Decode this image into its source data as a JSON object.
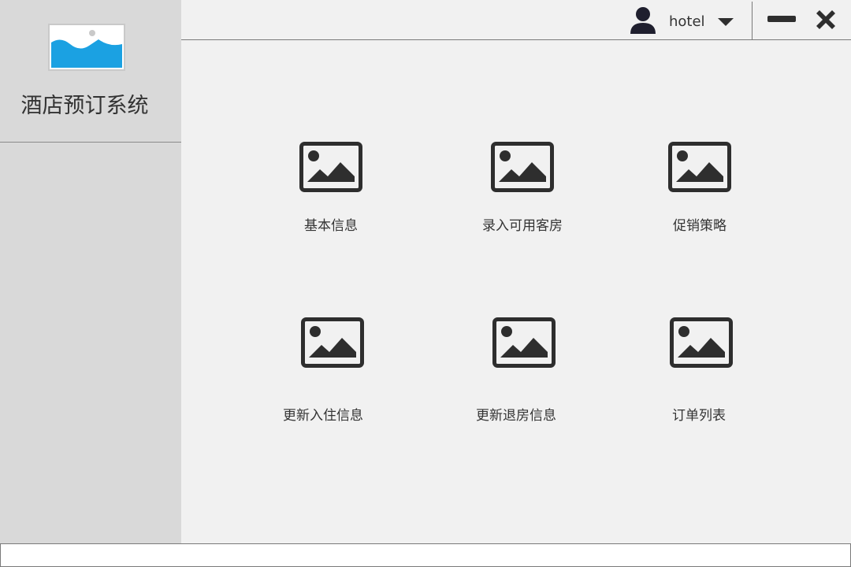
{
  "app": {
    "title": "酒店预订系统"
  },
  "header": {
    "username": "hotel"
  },
  "menu": [
    {
      "label": "基本信息",
      "icon": "image-icon"
    },
    {
      "label": "录入可用客房",
      "icon": "image-icon"
    },
    {
      "label": "促销策略",
      "icon": "image-icon"
    },
    {
      "label": "更新入住信息",
      "icon": "image-icon"
    },
    {
      "label": "更新退房信息",
      "icon": "image-icon"
    },
    {
      "label": "订单列表",
      "icon": "image-icon"
    }
  ],
  "colors": {
    "sidebar_bg": "#d9d9d9",
    "main_bg": "#f1f1f1",
    "logo_accent": "#1ba1e2",
    "icon_dark": "#2e2e2e"
  }
}
